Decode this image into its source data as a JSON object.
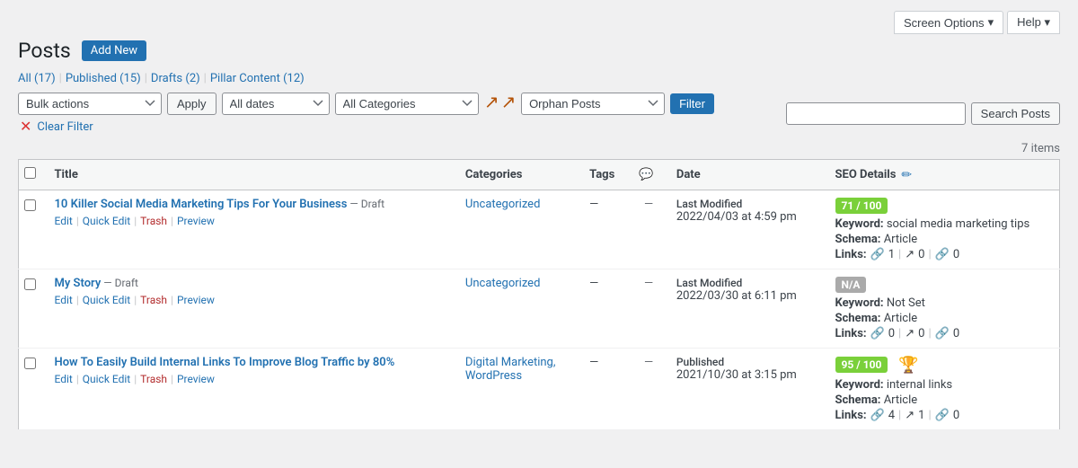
{
  "screen_options": {
    "label": "Screen Options",
    "chevron": "▾"
  },
  "help": {
    "label": "Help",
    "chevron": "▾"
  },
  "page": {
    "title": "Posts",
    "add_new_label": "Add New"
  },
  "filter_links": [
    {
      "label": "All",
      "count": "17",
      "id": "all"
    },
    {
      "label": "Published",
      "count": "15",
      "id": "published"
    },
    {
      "label": "Drafts",
      "count": "2",
      "id": "drafts"
    },
    {
      "label": "Pillar Content",
      "count": "12",
      "id": "pillar"
    }
  ],
  "tablenav": {
    "bulk_actions_label": "Bulk actions",
    "apply_label": "Apply",
    "dates_label": "All dates",
    "categories_label": "All Categories",
    "view_label": "Orphan Posts",
    "filter_label": "Filter",
    "clear_filter_label": "Clear Filter",
    "items_count": "7 items",
    "search_placeholder": "",
    "search_label": "Search Posts"
  },
  "table": {
    "col_title": "Title",
    "col_categories": "Categories",
    "col_tags": "Tags",
    "col_comments": "💬",
    "col_date": "Date",
    "col_seo": "SEO Details",
    "edit_icon": "✏"
  },
  "posts": [
    {
      "id": 1,
      "title": "10 Killer Social Media Marketing Tips For Your Business",
      "status": "Draft",
      "categories": [
        "Uncategorized"
      ],
      "tags": "—",
      "comments": "—",
      "date_label": "Last Modified",
      "date": "2022/04/03 at 4:59 pm",
      "seo_score": "71 / 100",
      "seo_badge_class": "good",
      "keyword_label": "Keyword:",
      "keyword": "social media marketing tips",
      "schema_label": "Schema:",
      "schema": "Article",
      "links_label": "Links:",
      "link1_icon": "🔗",
      "link1_count": "1",
      "link2_icon": "↗",
      "link2_count": "0",
      "link3_icon": "🔗",
      "link3_count": "0",
      "actions": [
        "Edit",
        "Quick Edit",
        "Trash",
        "Preview"
      ],
      "trophy": false
    },
    {
      "id": 2,
      "title": "My Story",
      "status": "Draft",
      "categories": [
        "Uncategorized"
      ],
      "tags": "—",
      "comments": "—",
      "date_label": "Last Modified",
      "date": "2022/03/30 at 6:11 pm",
      "seo_score": "N/A",
      "seo_badge_class": "na",
      "keyword_label": "Keyword:",
      "keyword": "Not Set",
      "schema_label": "Schema:",
      "schema": "Article",
      "links_label": "Links:",
      "link1_icon": "🔗",
      "link1_count": "0",
      "link2_icon": "↗",
      "link2_count": "0",
      "link3_icon": "🔗",
      "link3_count": "0",
      "actions": [
        "Edit",
        "Quick Edit",
        "Trash",
        "Preview"
      ],
      "trophy": false
    },
    {
      "id": 3,
      "title": "How To Easily Build Internal Links To Improve Blog Traffic by 80%",
      "status": null,
      "categories": [
        "Digital Marketing,",
        "WordPress"
      ],
      "tags": "—",
      "comments": "—",
      "date_label": "Published",
      "date": "2021/10/30 at 3:15 pm",
      "seo_score": "95 / 100",
      "seo_badge_class": "good",
      "keyword_label": "Keyword:",
      "keyword": "internal links",
      "schema_label": "Schema:",
      "schema": "Article",
      "links_label": "Links:",
      "link1_icon": "🔗",
      "link1_count": "4",
      "link2_icon": "↗",
      "link2_count": "1",
      "link3_icon": "🔗",
      "link3_count": "0",
      "actions": [
        "Edit",
        "Quick Edit",
        "Trash",
        "Preview"
      ],
      "trophy": true
    }
  ],
  "arrows": {
    "arrow1": "↙",
    "arrow2": "↙"
  }
}
